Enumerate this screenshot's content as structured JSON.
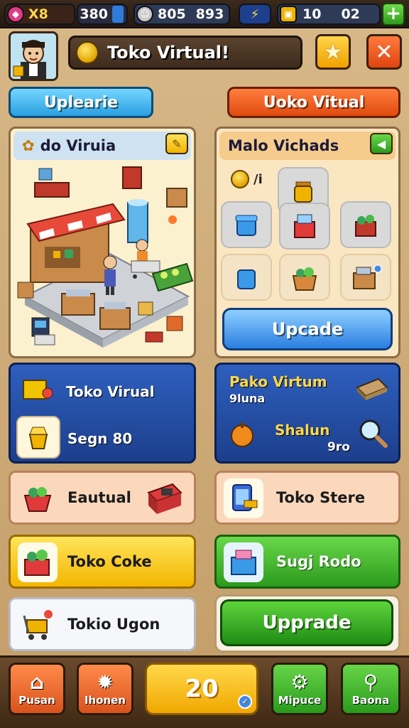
{
  "resources": {
    "gems": "X8",
    "coins": "380",
    "boosts": "805",
    "trophies": "893",
    "energy": "10",
    "keys": "02"
  },
  "header": {
    "title": "Toko Virtual!"
  },
  "tabs": {
    "left": "Uplearie",
    "right": "Uoko Vitual"
  },
  "store_panel": {
    "title": "do Viruia"
  },
  "items_panel": {
    "title": "Malo Vichads",
    "mini_label": "/i",
    "upgrade": "Upcade"
  },
  "card_left": {
    "title": "Toko Virual",
    "value": "Segn 80"
  },
  "card_right": {
    "title": "Pako Virtum",
    "subtitle": "9luna",
    "item": "Shalun",
    "value": "9ro"
  },
  "list": {
    "row1_left": "Eautual",
    "row1_right": "Toko Stere",
    "row2_left": "Toko Coke",
    "row2_right": "Sugj Rodo",
    "row3_left": "Tokio Ugon",
    "upgrade": "Upprade"
  },
  "nav": {
    "home": "Pusan",
    "settings": "Ihonen",
    "center": "20",
    "gear": "Mipuce",
    "search": "Baona"
  },
  "colors": {
    "accent_blue": "#2a7ee0",
    "accent_green": "#2c9a1c",
    "accent_orange": "#e04b0e",
    "accent_yellow": "#f3b600"
  }
}
